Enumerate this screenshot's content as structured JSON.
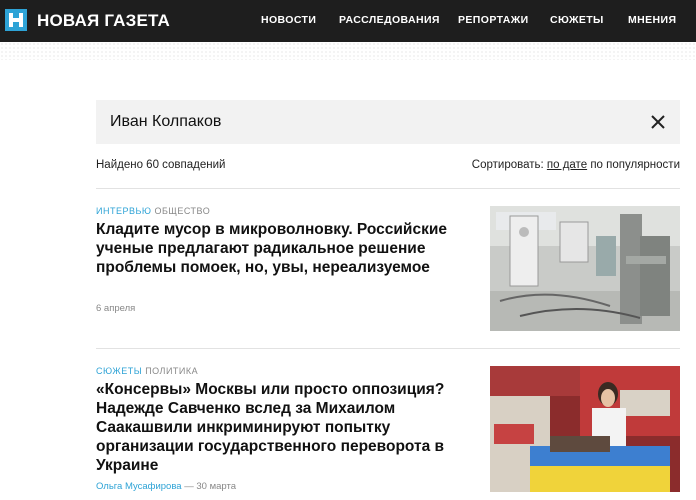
{
  "header": {
    "logo_text": "НОВАЯ ГАЗЕТА",
    "nav": [
      "НОВОСТИ",
      "РАССЛЕДОВАНИЯ",
      "РЕПОРТАЖИ",
      "СЮЖЕТЫ",
      "МНЕНИЯ"
    ]
  },
  "search": {
    "query": "Иван Колпаков",
    "clear_icon": "close-icon"
  },
  "results": {
    "found_text": "Найдено 60 совпадений",
    "sort_label": "Сортировать:",
    "sort_options": [
      "по дате",
      "по популярности"
    ],
    "sort_active": "по дате"
  },
  "articles": [
    {
      "rubric": "ИНТЕРВЬЮ",
      "section": "ОБЩЕСТВО",
      "title": "Кладите мусор в микроволновку. Российские ученые предлагают радикальное решение проблемы помоек, но, увы, нереализуемое",
      "author": "",
      "date": "6 апреля"
    },
    {
      "rubric": "СЮЖЕТЫ",
      "section": "ПОЛИТИКА",
      "title": "«Консервы» Москвы или просто оппозиция? Надежде Савченко вслед за Михаилом Саакашвили инкриминируют попытку организации государственного переворота в Украине",
      "author": "Ольга Мусафирова",
      "date": "30 марта"
    }
  ],
  "colors": {
    "header_bg": "#1e1e1e",
    "accent": "#2ea3d6",
    "search_bg": "#f2f2f2"
  }
}
